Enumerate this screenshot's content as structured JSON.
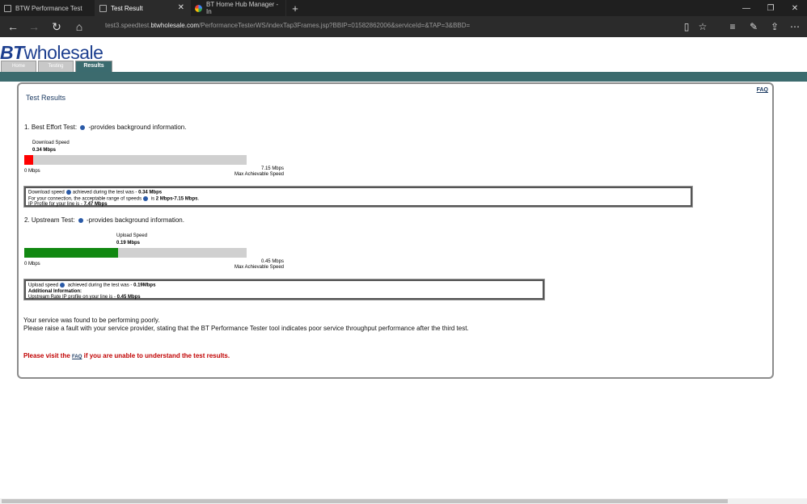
{
  "browser": {
    "tabs": [
      {
        "title": "BTW Performance Test"
      },
      {
        "title": "Test Result"
      },
      {
        "title": "BT Home Hub Manager - In"
      }
    ],
    "new_tab": "+",
    "url_prefix": "test3.speedtest.",
    "url_domain": "btwholesale.com",
    "url_path": "/PerformanceTesterWS/indexTap3Frames.jsp?BBIP=01582862006&serviceId=&TAP=3&BBD="
  },
  "site": {
    "logo_bt": "BT",
    "logo_word": "wholesale",
    "nav": [
      "Home",
      "Testing",
      "Results"
    ]
  },
  "results": {
    "title": "Test Results",
    "faq": "FAQ",
    "best_effort": {
      "heading_pre": "1. Best Effort Test: ",
      "heading_post": " -provides background information.",
      "label": "Download  Speed",
      "value": "0.34 Mbps",
      "min_label": "0 Mbps",
      "max_value": "7.15 Mbps",
      "max_label": "Max Achievable Speed",
      "fill_fraction": 0.04,
      "fill_color": "#ff0000",
      "info_l1_pre": "Download speed",
      "info_l1_mid": "achieved during the test was - ",
      "info_l1_val": "0.34 Mbps",
      "info_l2_pre": "For your connection, the acceptable range of speeds",
      "info_l2_mid": " is ",
      "info_l2_val": "2 Mbps-7.15 Mbps",
      "info_l2_end": ".",
      "info_l3_pre": "IP Profile for your line is - ",
      "info_l3_val": "7.47 Mbps"
    },
    "upstream": {
      "heading_pre": "2. Upstream Test: ",
      "heading_post": " -provides background information.",
      "label": "Upload Speed",
      "value": "0.19 Mbps",
      "min_label": "0 Mbps",
      "max_value": "0.45 Mbps",
      "max_label": "Max Achievable Speed",
      "fill_fraction": 0.42,
      "fill_color": "#118811",
      "info_l1_pre": "Upload speed",
      "info_l1_mid": " achieved during the test was - ",
      "info_l1_val": "0.19Mbps",
      "info_l2": "Additional Information:",
      "info_l3_pre": "Upstream Rate IP profile on your line is - ",
      "info_l3_val": "0.45 Mbps"
    },
    "message_l1": "Your service was found to be performing poorly.",
    "message_l2": "Please raise a fault with your service provider, stating that the BT Performance Tester tool indicates poor service throughput performance after the third test.",
    "visit_pre": "Please visit the ",
    "visit_link": "FAQ",
    "visit_post": " if you are unable to understand the test results."
  }
}
